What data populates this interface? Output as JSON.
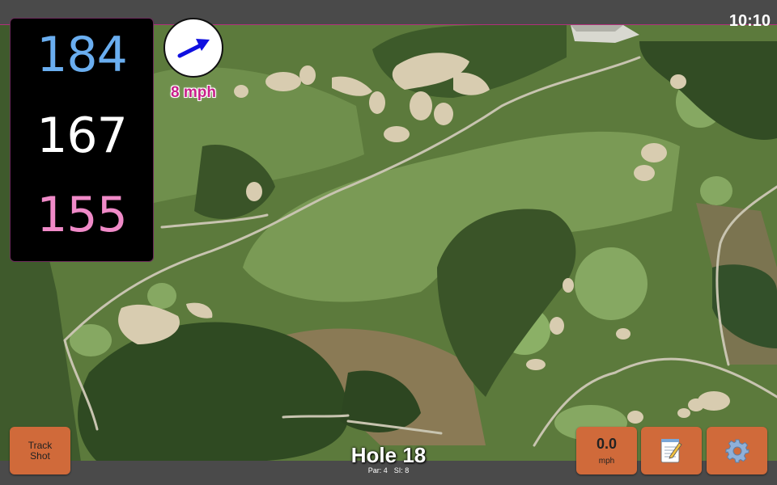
{
  "status": {
    "time": "10:10"
  },
  "distances": {
    "back": "184",
    "center": "167",
    "front": "155",
    "colors": {
      "back": "#6aaef0",
      "center": "#ffffff",
      "front": "#f08ac8"
    }
  },
  "wind": {
    "speed": "8 mph",
    "direction_icon": "arrow-icon",
    "arrow_color": "#1010e0",
    "speed_color": "#c8208a"
  },
  "buttons": {
    "track_shot": {
      "line1": "Track",
      "line2": "Shot"
    },
    "speed": {
      "value": "0.0",
      "unit": "mph"
    },
    "notes_icon": "notepad-icon",
    "settings_icon": "gear-icon"
  },
  "hole": {
    "title": "Hole 18",
    "par": "Par: 4",
    "si": "SI: 8"
  },
  "colors": {
    "button": "#d06a3a",
    "panel": "#000000",
    "bar": "#4a4a4a"
  }
}
